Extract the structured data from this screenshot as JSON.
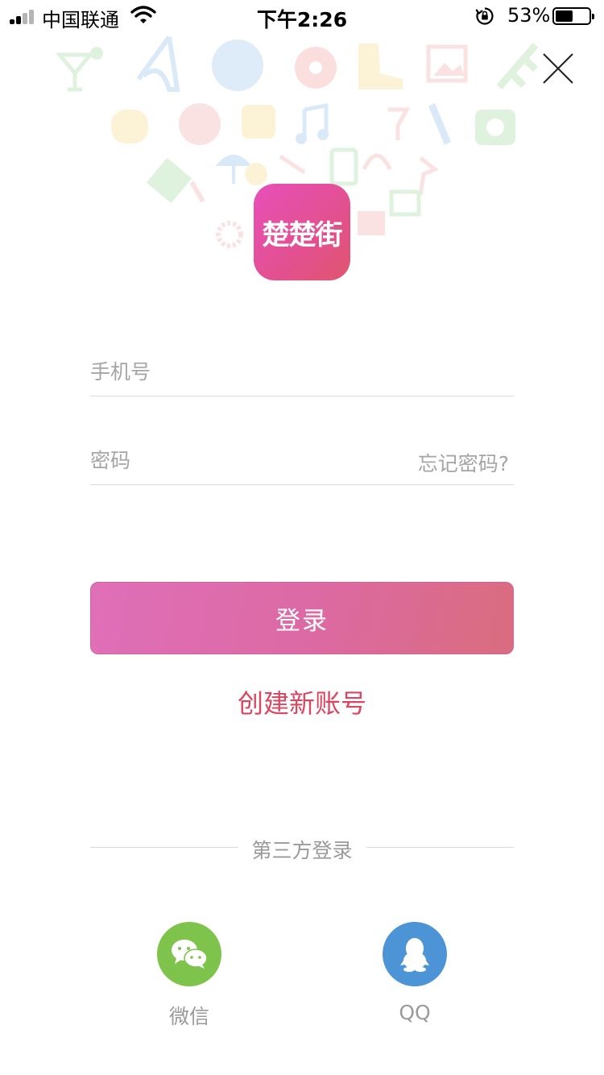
{
  "status_bar": {
    "carrier": "中国联通",
    "time": "下午2:26",
    "battery_percent": "53%",
    "battery_level": 0.53,
    "icons": [
      "signal-icon",
      "wifi-icon",
      "rotation-lock-icon",
      "battery-icon"
    ]
  },
  "header": {
    "close_icon": "close-icon"
  },
  "logo": {
    "text": "楚楚街",
    "colors": [
      "#e84fb9",
      "#e2556f"
    ]
  },
  "form": {
    "phone_placeholder": "手机号",
    "password_placeholder": "密码",
    "forgot_password": "忘记密码?",
    "login_button": "登录",
    "create_account": "创建新账号"
  },
  "third_party": {
    "title": "第三方登录",
    "options": [
      {
        "label": "微信",
        "icon": "wechat-icon",
        "color": "#7ec34b"
      },
      {
        "label": "QQ",
        "icon": "qq-icon",
        "color": "#4d94d6"
      }
    ]
  },
  "colors": {
    "accent": "#d8465f",
    "button_gradient_start": "#df6fb8",
    "button_gradient_end": "#d96c7e"
  }
}
